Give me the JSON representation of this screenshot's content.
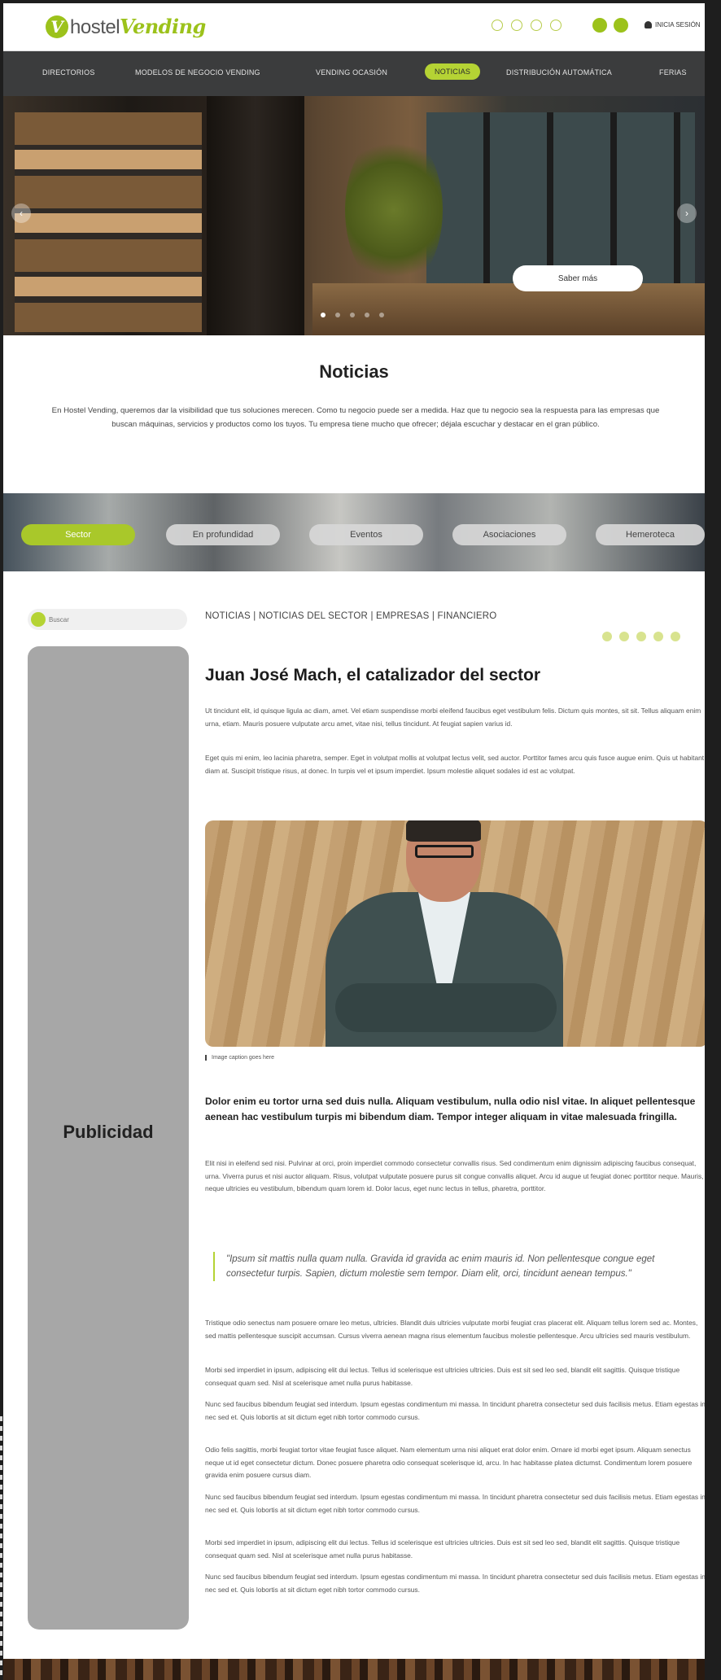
{
  "header": {
    "logo_prefix": "hostel",
    "logo_suffix": "Vending",
    "login_label": "INICIA SESIÓN"
  },
  "nav": {
    "items": [
      "DIRECTORIOS",
      "MODELOS DE NEGOCIO VENDING",
      "VENDING OCASIÓN",
      "NOTICIAS",
      "DISTRIBUCIÓN AUTOMÁTICA",
      "FERIAS"
    ],
    "active": "NOTICIAS"
  },
  "hero": {
    "button_label": "Saber más",
    "slides": 5,
    "active_slide": 1
  },
  "intro": {
    "title": "Noticias",
    "text": "En Hostel Vending, queremos dar la visibilidad que tus soluciones merecen. Como tu negocio puede ser a medida. Haz que tu negocio sea la respuesta para las empresas que buscan máquinas, servicios y productos como los tuyos. Tu empresa tiene mucho que ofrecer; déjala escuchar y destacar en el gran público."
  },
  "tabs": [
    "Sector",
    "En profundidad",
    "Eventos",
    "Asociaciones",
    "Hemeroteca"
  ],
  "sidebar": {
    "search_placeholder": "Buscar",
    "ad_label": "Publicidad"
  },
  "article": {
    "breadcrumb": "NOTICIAS | NOTICIAS DEL SECTOR | EMPRESAS | FINANCIERO",
    "title": "Juan José Mach, el catalizador del sector",
    "para1": "Ut tincidunt elit, id quisque ligula ac diam, amet. Vel etiam suspendisse morbi eleifend faucibus eget vestibulum felis. Dictum quis montes, sit sit. Tellus aliquam enim urna, etiam. Mauris posuere vulputate arcu amet, vitae nisi, tellus tincidunt. At feugiat sapien varius id.",
    "para2": "Eget quis mi enim, leo lacinia pharetra, semper. Eget in volutpat mollis at volutpat lectus velit, sed auctor. Porttitor fames arcu quis fusce augue enim. Quis ut habitant diam at. Suscipit tristique risus, at donec. In turpis vel et ipsum imperdiet. Ipsum molestie aliquet sodales id est ac volutpat.",
    "caption": "Image caption goes here",
    "lead": "Dolor enim eu tortor urna sed duis nulla. Aliquam vestibulum, nulla odio nisl vitae. In aliquet pellentesque aenean hac vestibulum turpis mi bibendum diam. Tempor integer aliquam in vitae malesuada fringilla.",
    "para3": "Elit nisi in eleifend sed nisi. Pulvinar at orci, proin imperdiet commodo consectetur convallis risus. Sed condimentum enim dignissim adipiscing faucibus consequat, urna. Viverra purus et nisi auctor aliquam. Risus, volutpat vulputate posuere purus sit congue convallis aliquet. Arcu id augue ut feugiat donec porttitor neque. Mauris, neque ultricies eu vestibulum, bibendum quam lorem id. Dolor lacus, eget nunc lectus in tellus, pharetra, porttitor.",
    "quote": "\"Ipsum sit mattis nulla quam nulla. Gravida id gravida ac enim mauris id. Non pellentesque congue eget consectetur turpis. Sapien, dictum molestie sem tempor. Diam elit, orci, tincidunt aenean tempus.\"",
    "para4": "Tristique odio senectus nam posuere ornare leo metus, ultricies. Blandit duis ultricies vulputate morbi feugiat cras placerat elit. Aliquam tellus lorem sed ac. Montes, sed mattis pellentesque suscipit accumsan. Cursus viverra aenean magna risus elementum faucibus molestie pellentesque. Arcu ultricies sed mauris vestibulum.",
    "para5": "Morbi sed imperdiet in ipsum, adipiscing elit dui lectus. Tellus id scelerisque est ultricies ultricies. Duis est sit sed leo sed, blandit elit sagittis. Quisque tristique consequat quam sed. Nisl at scelerisque amet nulla purus habitasse.",
    "para6": "Nunc sed faucibus bibendum feugiat sed interdum. Ipsum egestas condimentum mi massa. In tincidunt pharetra consectetur sed duis facilisis metus. Etiam egestas in nec sed et. Quis lobortis at sit dictum eget nibh tortor commodo cursus.",
    "para7": "Odio felis sagittis, morbi feugiat tortor vitae feugiat fusce aliquet. Nam elementum urna nisi aliquet erat dolor enim. Ornare id morbi eget ipsum. Aliquam senectus neque ut id eget consectetur dictum. Donec posuere pharetra odio consequat scelerisque id, arcu. In hac habitasse platea dictumst. Condimentum lorem posuere gravida enim posuere cursus diam.",
    "para8": "Nunc sed faucibus bibendum feugiat sed interdum. Ipsum egestas condimentum mi massa. In tincidunt pharetra consectetur sed duis facilisis metus. Etiam egestas in nec sed et. Quis lobortis at sit dictum eget nibh tortor commodo cursus.",
    "para9": "Morbi sed imperdiet in ipsum, adipiscing elit dui lectus. Tellus id scelerisque est ultricies ultricies. Duis est sit sed leo sed, blandit elit sagittis. Quisque tristique consequat quam sed. Nisl at scelerisque amet nulla purus habitasse.",
    "para10": "Nunc sed faucibus bibendum feugiat sed interdum. Ipsum egestas condimentum mi massa. In tincidunt pharetra consectetur sed duis facilisis metus. Etiam egestas in nec sed et. Quis lobortis at sit dictum eget nibh tortor commodo cursus."
  },
  "colors": {
    "accent": "#9cc21b",
    "nav_bg": "#3b3c3d",
    "ad_bg": "#a7a7a7"
  },
  "icons": {
    "social": [
      "linkedin-icon",
      "instagram-icon",
      "x-icon",
      "facebook-icon"
    ],
    "share": [
      "link-icon",
      "facebook-icon",
      "instagram-icon",
      "x-icon",
      "linkedin-icon"
    ]
  }
}
